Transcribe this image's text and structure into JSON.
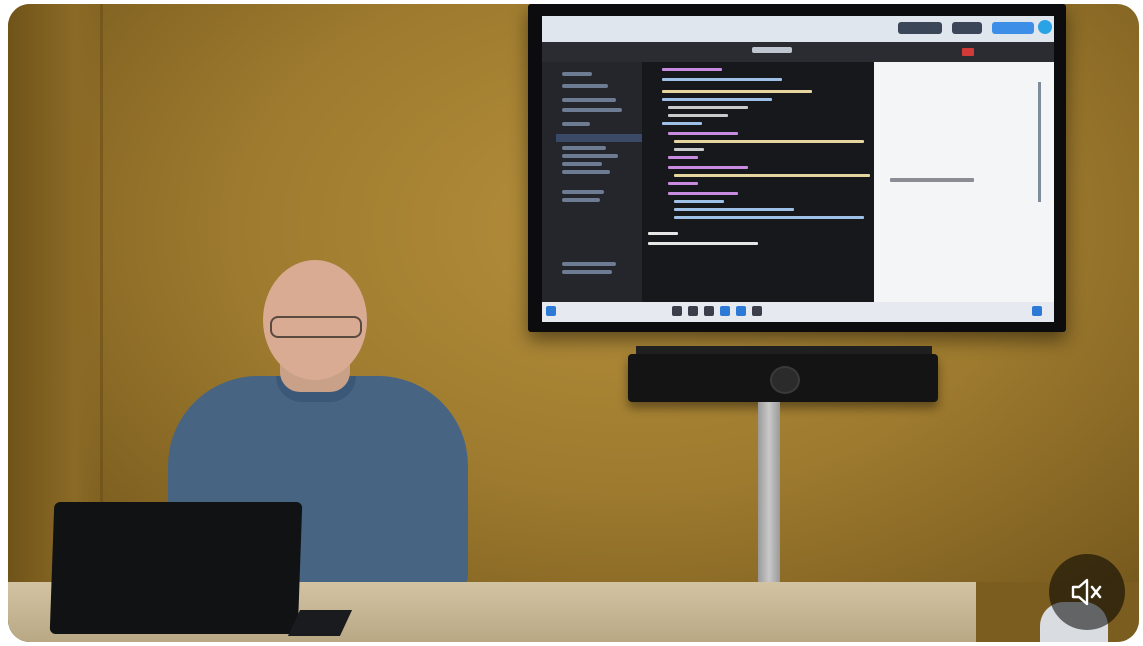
{
  "video": {
    "description_hidden": "",
    "muted": true
  },
  "controls": {
    "mute_icon": "speaker-muted-icon"
  },
  "colors": {
    "wall": "#9d7a2e",
    "shirt": "#476483",
    "table": "#c9b896",
    "mute_bg": "rgba(0,0,0,0.55)"
  }
}
